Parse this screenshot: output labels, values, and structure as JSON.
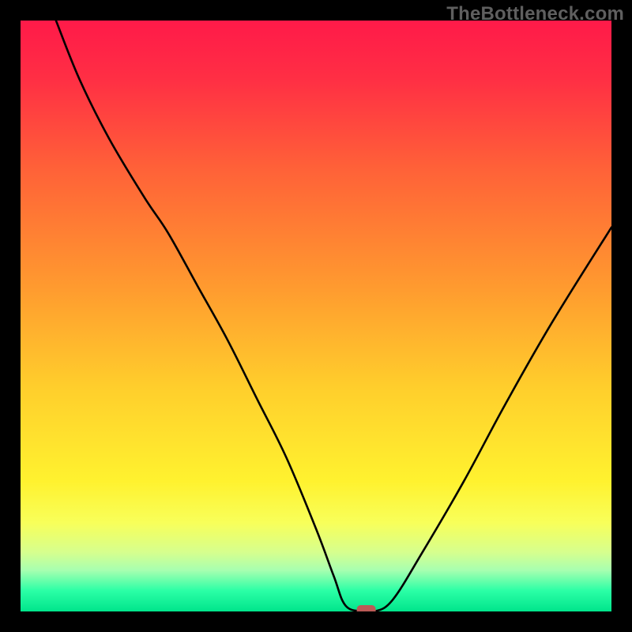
{
  "watermark": "TheBottleneck.com",
  "chart_data": {
    "type": "line",
    "title": "",
    "xlabel": "",
    "ylabel": "",
    "xlim": [
      0,
      100
    ],
    "ylim": [
      0,
      100
    ],
    "grid": false,
    "legend": false,
    "curve_note": "Single unlabeled curve descending steeply from upper-left, reaching a flat minimum near x≈55–60 at y≈0, then rising toward upper-right",
    "x": [
      6,
      10,
      15,
      21,
      25,
      30,
      35,
      40,
      45,
      50,
      53,
      55,
      58,
      60,
      63,
      68,
      75,
      82,
      90,
      100
    ],
    "y": [
      100,
      90,
      80,
      70,
      64,
      55,
      46,
      36,
      26,
      14,
      6,
      1,
      0,
      0,
      2,
      10,
      22,
      35,
      49,
      65
    ],
    "marker": {
      "x": 58.5,
      "y": 0,
      "shape": "rounded-rect",
      "color": "#bb5a56"
    },
    "gradient_stops": [
      {
        "offset": 0.0,
        "color": "#ff1a49"
      },
      {
        "offset": 0.1,
        "color": "#ff2f44"
      },
      {
        "offset": 0.25,
        "color": "#ff6138"
      },
      {
        "offset": 0.45,
        "color": "#ff9a2f"
      },
      {
        "offset": 0.62,
        "color": "#ffce2c"
      },
      {
        "offset": 0.78,
        "color": "#fff22f"
      },
      {
        "offset": 0.85,
        "color": "#f8ff5a"
      },
      {
        "offset": 0.9,
        "color": "#d6ff8e"
      },
      {
        "offset": 0.93,
        "color": "#a8ffb0"
      },
      {
        "offset": 0.965,
        "color": "#2bffa6"
      },
      {
        "offset": 1.0,
        "color": "#00e58b"
      }
    ]
  }
}
